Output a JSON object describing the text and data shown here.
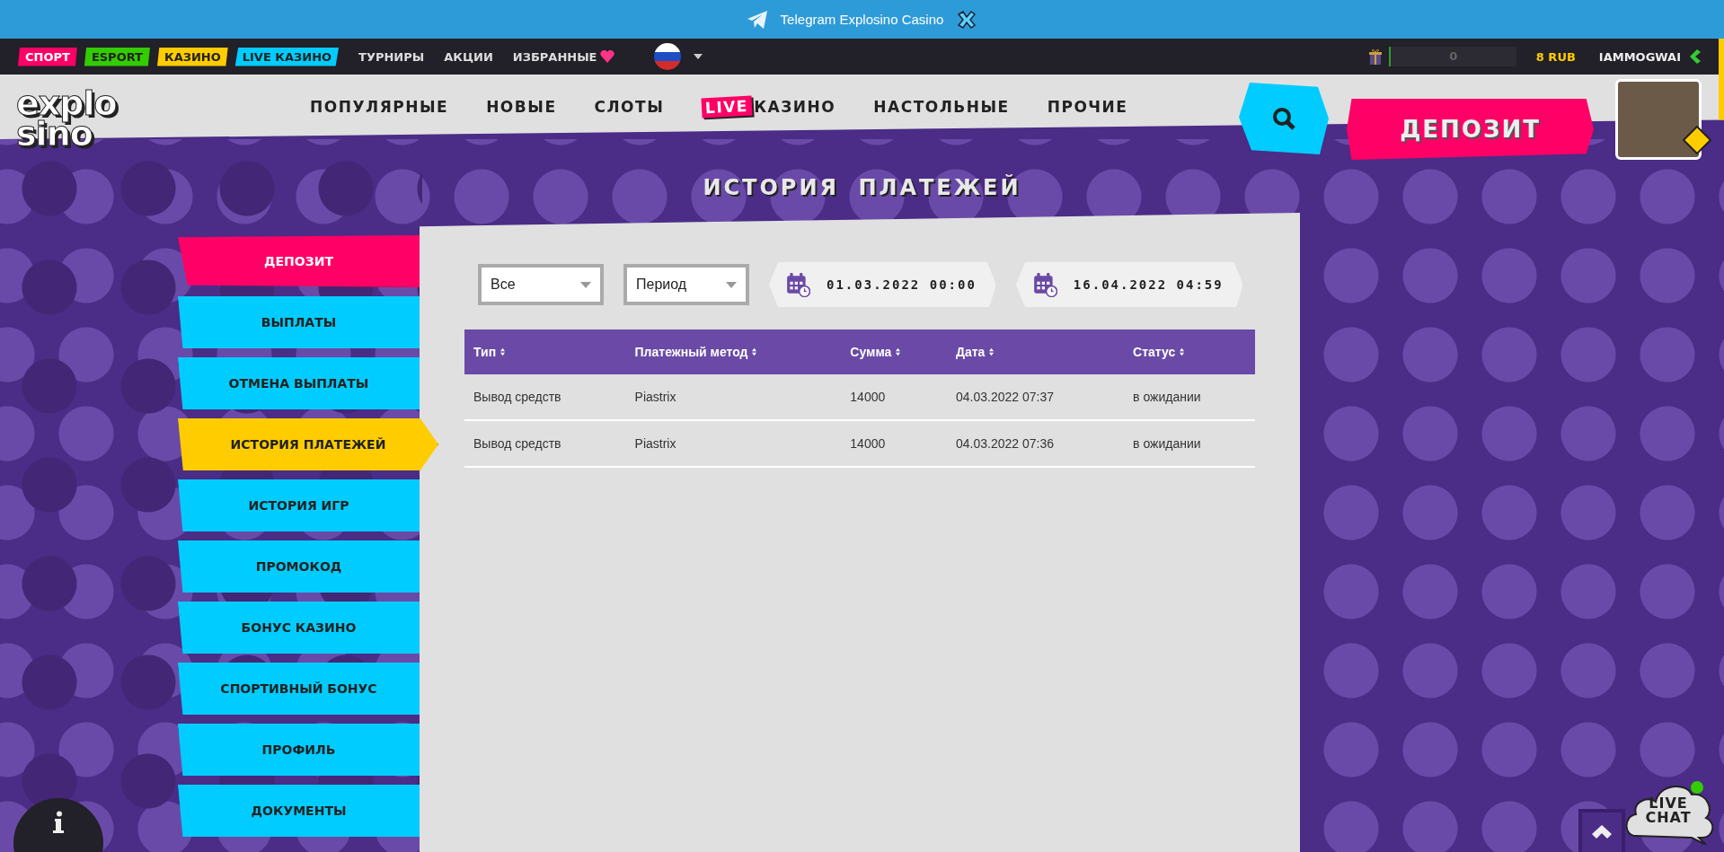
{
  "telegram_banner": {
    "text": "Telegram Explosino Casino"
  },
  "top_nav": {
    "tags": [
      {
        "label": "СПОРТ",
        "color": "#ff0066"
      },
      {
        "label": "ESPORT",
        "color": "#33cc00"
      },
      {
        "label": "КАЗИНО",
        "color": "#ffcc00"
      },
      {
        "label": "LIVE КАЗИНО",
        "color": "#00ccff"
      }
    ],
    "links": [
      "ТУРНИРЫ",
      "АКЦИИ"
    ],
    "favorites": "ИЗБРАННЫЕ",
    "bonus_balance": "0",
    "balance": "8 RUB",
    "username": "IAMMOGWAI"
  },
  "logo": {
    "lines": [
      "explo",
      "sino"
    ]
  },
  "main_menu": [
    {
      "label": "ПОПУЛЯРНЫЕ"
    },
    {
      "label": "НОВЫЕ"
    },
    {
      "label": "СЛОТЫ"
    },
    {
      "label": "КАЗИНО",
      "badge": "LIVE"
    },
    {
      "label": "НАСТОЛЬНЫЕ"
    },
    {
      "label": "ПРОЧИЕ"
    }
  ],
  "deposit_button": "ДЕПОЗИТ",
  "page_title": "ИСТОРИЯ ПЛАТЕЖЕЙ",
  "sidebar": {
    "items": [
      {
        "label": "ДЕПОЗИТ",
        "kind": "deposit",
        "selected": false
      },
      {
        "label": "ВЫПЛАТЫ",
        "kind": "link",
        "selected": false
      },
      {
        "label": "ОТМЕНА ВЫПЛАТЫ",
        "kind": "link",
        "selected": false
      },
      {
        "label": "ИСТОРИЯ ПЛАТЕЖЕЙ",
        "kind": "link",
        "selected": true
      },
      {
        "label": "ИСТОРИЯ ИГР",
        "kind": "link",
        "selected": false
      },
      {
        "label": "ПРОМОКОД",
        "kind": "link",
        "selected": false
      },
      {
        "label": "БОНУС КАЗИНО",
        "kind": "link",
        "selected": false
      },
      {
        "label": "СПОРТИВНЫЙ БОНУС",
        "kind": "link",
        "selected": false
      },
      {
        "label": "ПРОФИЛЬ",
        "kind": "link",
        "selected": false
      },
      {
        "label": "ДОКУМЕНТЫ",
        "kind": "link",
        "selected": false
      }
    ]
  },
  "filters": {
    "selects": [
      {
        "value": "Все"
      },
      {
        "value": "Период"
      }
    ],
    "dates": [
      "01.03.2022 00:00",
      "16.04.2022 04:59"
    ]
  },
  "table": {
    "columns": [
      "Тип",
      "Платежный метод",
      "Сумма",
      "Дата",
      "Статус"
    ],
    "rows": [
      [
        "Вывод средств",
        "Piastrix",
        "14000",
        "04.03.2022 07:37",
        "в ожидании"
      ],
      [
        "Вывод средств",
        "Piastrix",
        "14000",
        "04.03.2022 07:36",
        "в ожидании"
      ]
    ]
  },
  "live_chat": {
    "label": "LIVE CHAT"
  }
}
